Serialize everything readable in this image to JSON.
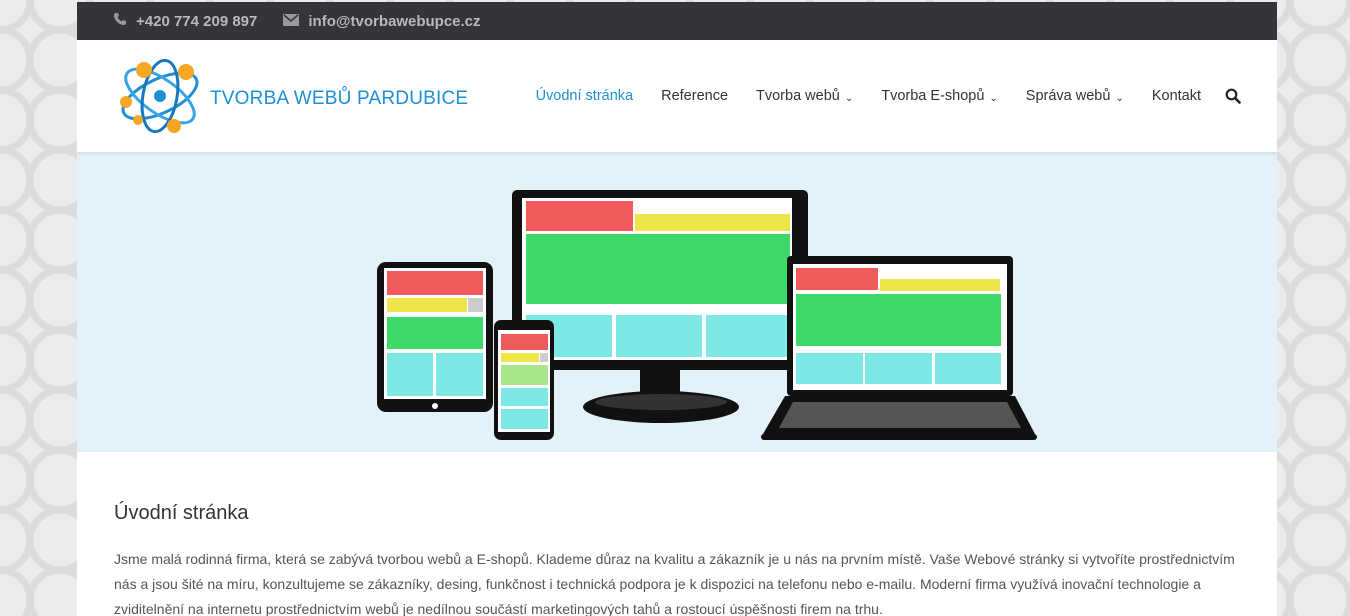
{
  "topbar": {
    "phone": "+420 774 209 897",
    "email": "info@tvorbawebupce.cz",
    "phone_icon": "phone-icon",
    "email_icon": "envelope-icon"
  },
  "header": {
    "logo_text": "TVORBA WEBŮ PARDUBICE",
    "nav": [
      {
        "label": "Úvodní stránka",
        "active": true
      },
      {
        "label": "Reference"
      },
      {
        "label": "Tvorba webů",
        "dropdown": true
      },
      {
        "label": "Tvorba E-shopů",
        "dropdown": true
      },
      {
        "label": "Správa webů",
        "dropdown": true
      },
      {
        "label": "Kontakt"
      }
    ],
    "search_icon": "search-icon"
  },
  "content": {
    "title": "Úvodní stránka",
    "paragraph": "Jsme malá rodinná firma, která se zabývá tvorbou webů a E-shopů. Klademe důraz na kvalitu a zákazník je u nás na prvním místě. Vaše Webové stránky si vytvoříte prostřednictvím nás a jsou šité na míru, konzultujeme se zákazníky, desing, funkčnost i technická podpora je k dispozici na telefonu nebo e-mailu. Moderní firma využívá inovační technologie a zviditelnění na internetu prostřednictvím webů je nedílnou součástí marketingových tahů a rostoucí úspěšnosti firem na trhu."
  },
  "colors": {
    "accent": "#1d8fd6",
    "topbar_bg": "#333538",
    "hero_bg": "#e3f2f8",
    "block_red": "#f05a5a",
    "block_yellow": "#ede54a",
    "block_green": "#3ed86b",
    "block_cyan": "#7ee8e6"
  }
}
